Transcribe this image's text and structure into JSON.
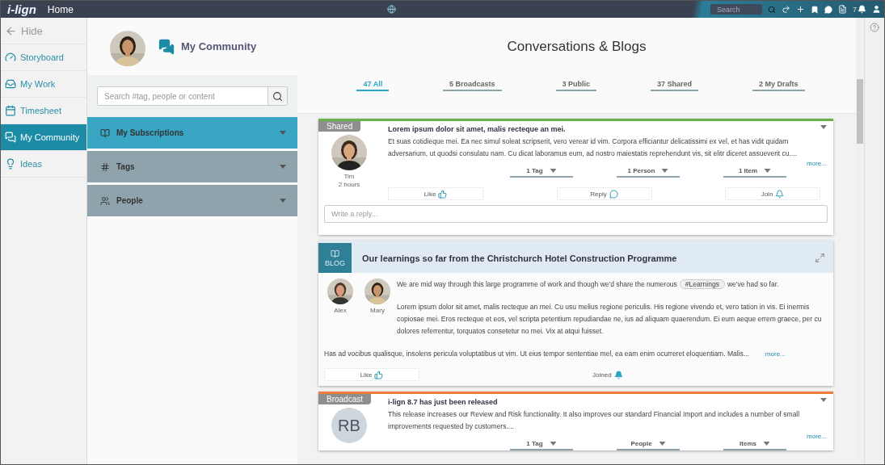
{
  "topbar": {
    "logo": "i-lign",
    "title": "Home",
    "search": {
      "placeholder": "Search"
    },
    "notifications": "7"
  },
  "nav": {
    "hide": "Hide",
    "items": [
      {
        "label": "Storyboard",
        "selected": false
      },
      {
        "label": "My Work",
        "selected": false
      },
      {
        "label": "Timesheet",
        "selected": false
      },
      {
        "label": "My Community",
        "selected": true
      },
      {
        "label": "Ideas",
        "selected": false
      }
    ]
  },
  "community": {
    "title": "My Community",
    "search": {
      "placeholder": "Search #tag, people or content"
    },
    "sections": [
      {
        "label": "My Subscriptions",
        "expanded": true
      },
      {
        "label": "Tags",
        "expanded": false
      },
      {
        "label": "People",
        "expanded": false
      }
    ]
  },
  "main": {
    "title": "Conversations & Blogs",
    "tabs": [
      {
        "label": "47 All",
        "selected": true
      },
      {
        "label": "5 Broadcasts",
        "selected": false
      },
      {
        "label": "3 Public",
        "selected": false
      },
      {
        "label": "37 Shared",
        "selected": false
      },
      {
        "label": "2 My Drafts",
        "selected": false
      }
    ],
    "feed": [
      {
        "kind": "post",
        "badge": "Shared",
        "color": "#6ab04c",
        "author": "Tim",
        "time": "2 hours",
        "title": "Lorem ipsum dolor sit amet, malis recteque an mei.",
        "body": "Et suas cotidieque mei. Ea nec simul soleat scripserit, vero verear id vim. Corpora efficiantur delicatissimi ex vel, et has vidit quidam adversarium, ut quodsi consulatu nam. Cu dicat laboramus eum, ad nostro maiestatis reprehendunt vis, sit elitr diceret assueverit cu....",
        "more": "more...",
        "filters": [
          "1 Tag",
          "1 Person",
          "1 Item"
        ],
        "actions": {
          "like": "Like",
          "reply": "Reply",
          "join": "Join",
          "joined": false
        },
        "reply_placeholder": "Write a reply..."
      },
      {
        "kind": "blog",
        "badge": "BLOG",
        "title": "Our learnings so far from the Christchurch Hotel Construction Programme",
        "authors": [
          "Alex",
          "Mary"
        ],
        "intro": {
          "before": "We are mid way through this large programme of work and though we'd share the numerous",
          "tag": "#Learnings",
          "after": "we've had so far."
        },
        "paragraphs": [
          "Lorem ipsum dolor sit amet, malis recteque an mei. Cu usu melius regione periculis. His regione vivendo et, vero tation in vis. Ei inermis copiosae mei. Eros recteque et eos, vel scripta petentium repudiandae ne, ius ad aliquam quaerendum. Ei eum aeque errem graece, per cu dolores referrentur, torquatos consetetur no mei. Vix at atqui fuisset.",
          "Has ad vocibus qualisque, insolens pericula voluptatibus ut vim. Ut eius tempor sententiae mel, ea eam enim ocurreret eloquentiam. Malis..."
        ],
        "more": "more...",
        "actions": {
          "like": "Like",
          "join": "Joined",
          "joined": true
        }
      },
      {
        "kind": "post",
        "badge": "Broadcast",
        "color": "#f07c3c",
        "avatar": {
          "kind": "initials",
          "text": "RB"
        },
        "title": "i-lign 8.7 has just been released",
        "body": "This release increases our Review and Risk functionality. It also improves our standard Financial Import and includes a number of small improvements requested by customers....",
        "more": "more...",
        "filters": [
          "1 Tag",
          "People",
          "Items"
        ]
      }
    ]
  }
}
